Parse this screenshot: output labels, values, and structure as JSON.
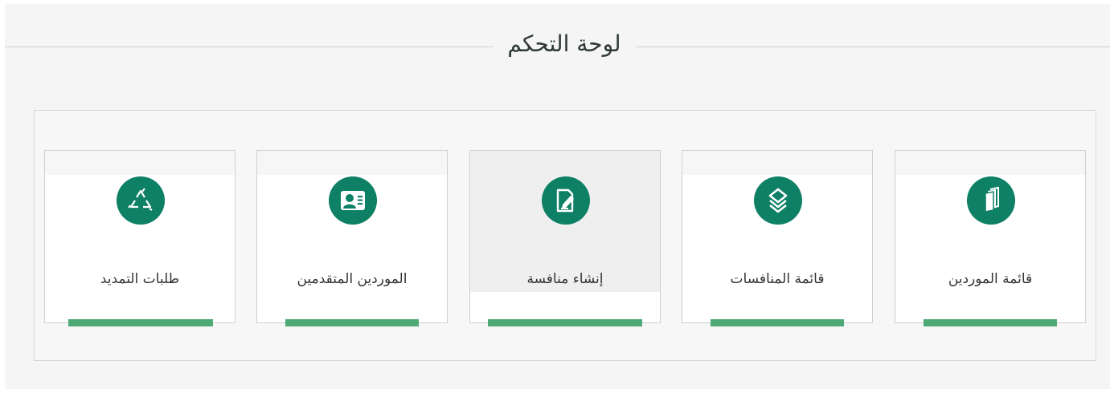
{
  "page_title": "لوحة التحكم",
  "accent_color": "#0e8065",
  "bar_color": "#4daa76",
  "cards": [
    {
      "label": "قائمة الموردين",
      "icon": "documents-stack-icon"
    },
    {
      "label": "قائمة المنافسات",
      "icon": "layers-icon"
    },
    {
      "label": "إنشاء منافسة",
      "icon": "edit-document-icon"
    },
    {
      "label": "الموردين المتقدمين",
      "icon": "user-card-icon"
    },
    {
      "label": "طلبات التمديد",
      "icon": "recycle-icon"
    }
  ]
}
